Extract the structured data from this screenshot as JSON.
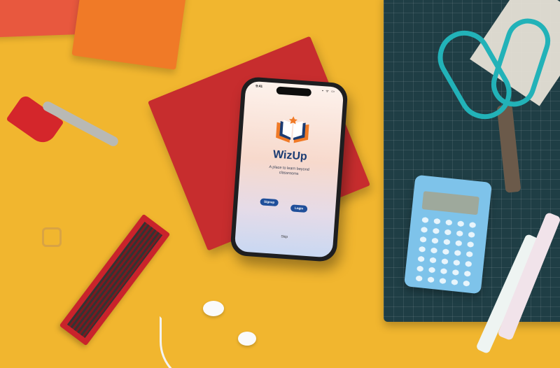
{
  "status_bar": {
    "time": "9:41",
    "icons": "▪ ᯤ ▭"
  },
  "app": {
    "name": "WizUp",
    "tagline": "A place to learn beyond classrooms",
    "signup_label": "Signup",
    "login_label": "Login",
    "skip_label": "Skip"
  },
  "colors": {
    "background": "#f1b62f",
    "brand_primary": "#1b3c73",
    "button": "#1f4f9a",
    "logo_orange": "#f07a27"
  },
  "icons": {
    "logo": "open-book-icon"
  }
}
